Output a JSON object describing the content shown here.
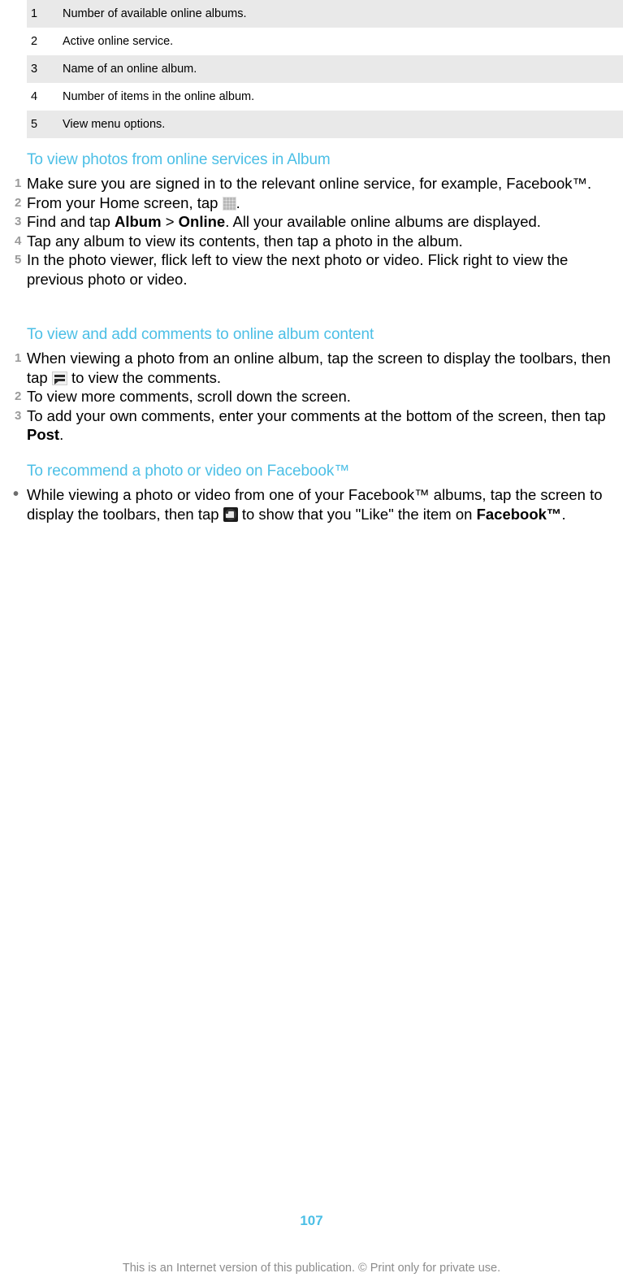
{
  "document": {
    "page_number": "107",
    "footer_note": "This is an Internet version of this publication. © Print only for private use.",
    "accent_color": "#4cbfe6",
    "table_shade_color": "#e9e9e9",
    "marker_color": "#9a9a9a"
  },
  "legend_table": {
    "rows": [
      {
        "num": "1",
        "text": "Number of available online albums."
      },
      {
        "num": "2",
        "text": "Active online service."
      },
      {
        "num": "3",
        "text": "Name of an online album."
      },
      {
        "num": "4",
        "text": "Number of items in the online album."
      },
      {
        "num": "5",
        "text": "View menu options."
      }
    ]
  },
  "sections": [
    {
      "heading": "To view photos from online services in Album",
      "list_type": "ordered",
      "steps": [
        {
          "marker": "1",
          "parts": [
            {
              "type": "text",
              "value": "Make sure you are signed in to the relevant online service, for example, Facebook™."
            }
          ]
        },
        {
          "marker": "2",
          "parts": [
            {
              "type": "text",
              "value": "From your Home screen, tap "
            },
            {
              "type": "icon",
              "value": "app-grid-icon"
            },
            {
              "type": "text",
              "value": "."
            }
          ]
        },
        {
          "marker": "3",
          "parts": [
            {
              "type": "text",
              "value": "Find and tap "
            },
            {
              "type": "bold",
              "value": "Album"
            },
            {
              "type": "text",
              "value": " > "
            },
            {
              "type": "bold",
              "value": "Online"
            },
            {
              "type": "text",
              "value": ". All your available online albums are displayed."
            }
          ]
        },
        {
          "marker": "4",
          "parts": [
            {
              "type": "text",
              "value": "Tap any album to view its contents, then tap a photo in the album."
            }
          ]
        },
        {
          "marker": "5",
          "parts": [
            {
              "type": "text",
              "value": "In the photo viewer, flick left to view the next photo or video. Flick right to view the previous photo or video."
            }
          ]
        }
      ]
    },
    {
      "heading": "To view and add comments to online album content",
      "list_type": "ordered",
      "steps": [
        {
          "marker": "1",
          "parts": [
            {
              "type": "text",
              "value": "When viewing a photo from an online album, tap the screen to display the toolbars, then tap "
            },
            {
              "type": "icon",
              "value": "comment-icon"
            },
            {
              "type": "text",
              "value": " to view the comments."
            }
          ]
        },
        {
          "marker": "2",
          "parts": [
            {
              "type": "text",
              "value": "To view more comments, scroll down the screen."
            }
          ]
        },
        {
          "marker": "3",
          "parts": [
            {
              "type": "text",
              "value": "To add your own comments, enter your comments at the bottom of the screen, then tap "
            },
            {
              "type": "bold",
              "value": "Post"
            },
            {
              "type": "text",
              "value": "."
            }
          ]
        }
      ]
    },
    {
      "heading": "To recommend a photo or video on Facebook™",
      "list_type": "bulleted",
      "steps": [
        {
          "marker": "•",
          "parts": [
            {
              "type": "text",
              "value": "While viewing a photo or video from one of your Facebook™ albums, tap the screen to display the toolbars, then tap "
            },
            {
              "type": "icon",
              "value": "thumbs-up-icon"
            },
            {
              "type": "text",
              "value": " to show that you \"Like\" the item on "
            },
            {
              "type": "bold",
              "value": "Facebook™"
            },
            {
              "type": "text",
              "value": "."
            }
          ]
        }
      ]
    }
  ]
}
